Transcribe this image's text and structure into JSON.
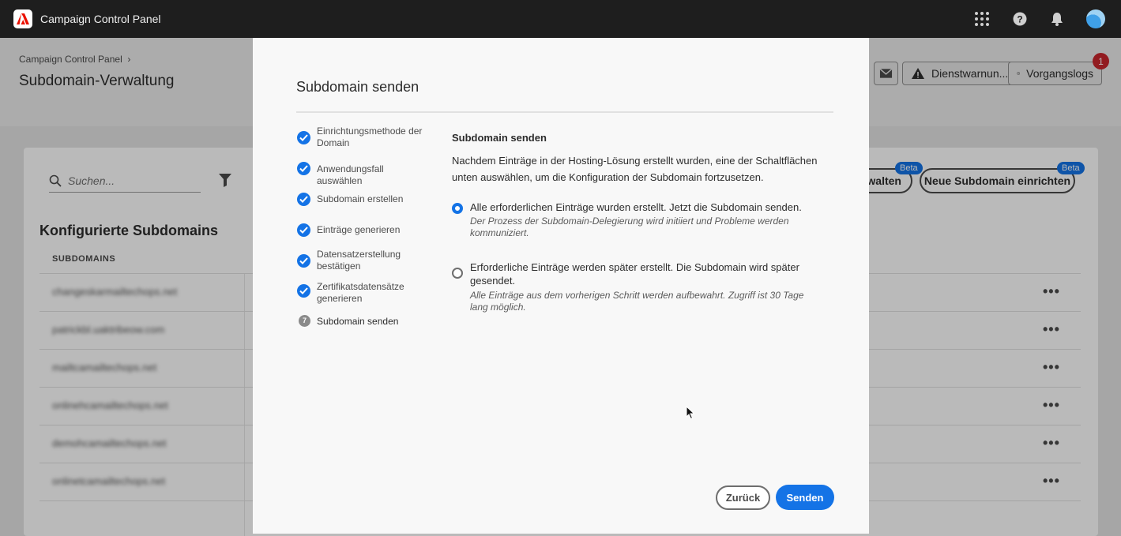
{
  "app": {
    "title": "Campaign Control Panel"
  },
  "breadcrumb": {
    "root": "Campaign Control Panel"
  },
  "page": {
    "title": "Subdomain-Verwaltung"
  },
  "header_buttons": {
    "warnings_label": "Dienstwarnun...",
    "logs_label": "Vorgangslogs",
    "logs_badge": "1"
  },
  "toolbar": {
    "search_placeholder": "Suchen...",
    "manage_label": "walten",
    "new_subdomain_label": "Neue Subdomain einrichten",
    "beta_label": "Beta"
  },
  "table": {
    "section_title": "Konfigurierte Subdomains",
    "column_header": "SUBDOMAINS",
    "rows": [
      "changeskarmailtechops.net",
      "patrickbl.uaktribeow.com",
      "mailtcamailtechops.net",
      "onlinehcamailtechops.net",
      "demohcamailtechops.net",
      "onlinetcamailtechops.net"
    ],
    "row_menu": "•••"
  },
  "modal": {
    "title": "Subdomain senden",
    "steps": [
      {
        "label": "Einrichtungsmethode der Domain",
        "state": "done"
      },
      {
        "label": "Anwendungsfall auswählen",
        "state": "done"
      },
      {
        "label": "Subdomain erstellen",
        "state": "done"
      },
      {
        "label": "Einträge generieren",
        "state": "done"
      },
      {
        "label": "Datensatzerstellung bestätigen",
        "state": "done"
      },
      {
        "label": "Zertifikatsdatensätze generieren",
        "state": "done"
      },
      {
        "label": "Subdomain senden",
        "state": "current",
        "number": "7"
      }
    ],
    "content_title": "Subdomain senden",
    "content_description": "Nachdem Einträge in der Hosting-Lösung erstellt wurden, eine der Schaltflächen unten auswählen, um die Konfiguration der Subdomain fortzusetzen.",
    "options": [
      {
        "label": "Alle erforderlichen Einträge wurden erstellt. Jetzt die Subdomain senden.",
        "description": "Der Prozess der Subdomain-Delegierung wird initiiert und Probleme werden kommuniziert.",
        "selected": true
      },
      {
        "label": "Erforderliche Einträge werden später erstellt. Die Subdomain wird später gesendet.",
        "description": "Alle Einträge aus dem vorherigen Schritt werden aufbewahrt. Zugriff ist 30 Tage lang möglich.",
        "selected": false
      }
    ],
    "back_label": "Zurück",
    "send_label": "Senden"
  },
  "colors": {
    "accent": "#1473e6",
    "badge": "#c9252d",
    "topbar": "#1e1e1e"
  }
}
